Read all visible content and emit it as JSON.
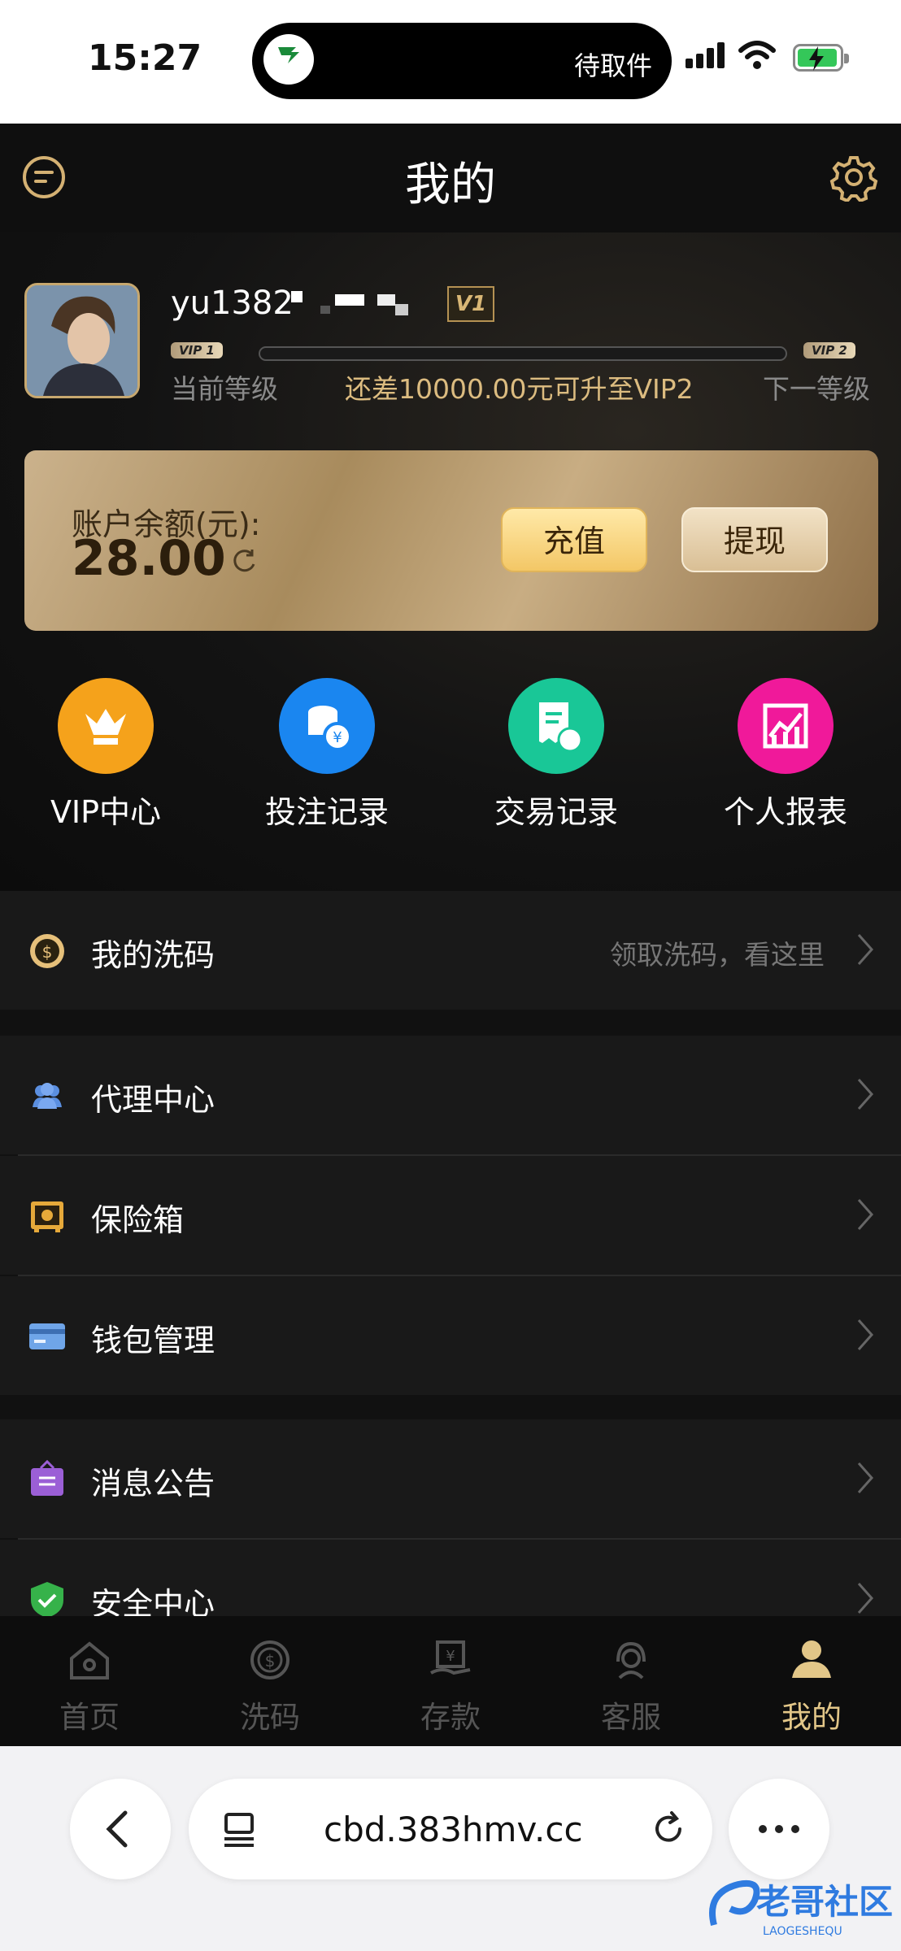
{
  "status_bar": {
    "time": "15:27",
    "island_text": "待取件"
  },
  "header": {
    "title": "我的"
  },
  "profile": {
    "username": "yu1382",
    "vip_badge": "V1",
    "current_level_chip": "VIP 1",
    "next_level_chip": "VIP 2",
    "current_level_label": "当前等级",
    "upgrade_hint": "还差10000.00元可升至VIP2",
    "next_level_label": "下一等级",
    "progress_fraction": 0
  },
  "balance": {
    "label": "账户余额(元):",
    "value": "28.00",
    "recharge_label": "充值",
    "withdraw_label": "提现"
  },
  "shortcuts": [
    {
      "label": "VIP中心",
      "color": "#f5a21b"
    },
    {
      "label": "投注记录",
      "color": "#1a86f0"
    },
    {
      "label": "交易记录",
      "color": "#19c797"
    },
    {
      "label": "个人报表",
      "color": "#f0199a"
    }
  ],
  "menu": {
    "wash": {
      "label": "我的洗码",
      "hint": "领取洗码，看这里"
    },
    "agent": {
      "label": "代理中心"
    },
    "safe": {
      "label": "保险箱"
    },
    "wallet": {
      "label": "钱包管理"
    },
    "notice": {
      "label": "消息公告"
    },
    "security": {
      "label": "安全中心"
    }
  },
  "tabs": [
    {
      "label": "首页",
      "icon": "home-icon"
    },
    {
      "label": "洗码",
      "icon": "coin-icon"
    },
    {
      "label": "存款",
      "icon": "deposit-icon"
    },
    {
      "label": "客服",
      "icon": "support-icon"
    },
    {
      "label": "我的",
      "icon": "user-icon"
    }
  ],
  "browser": {
    "url": "cbd.383hmv.cc"
  },
  "watermark": {
    "text": "老哥社区",
    "subtext": "LAOGESHEQU"
  },
  "colors": {
    "accent_gold": "#e2c688",
    "background": "#111111"
  }
}
